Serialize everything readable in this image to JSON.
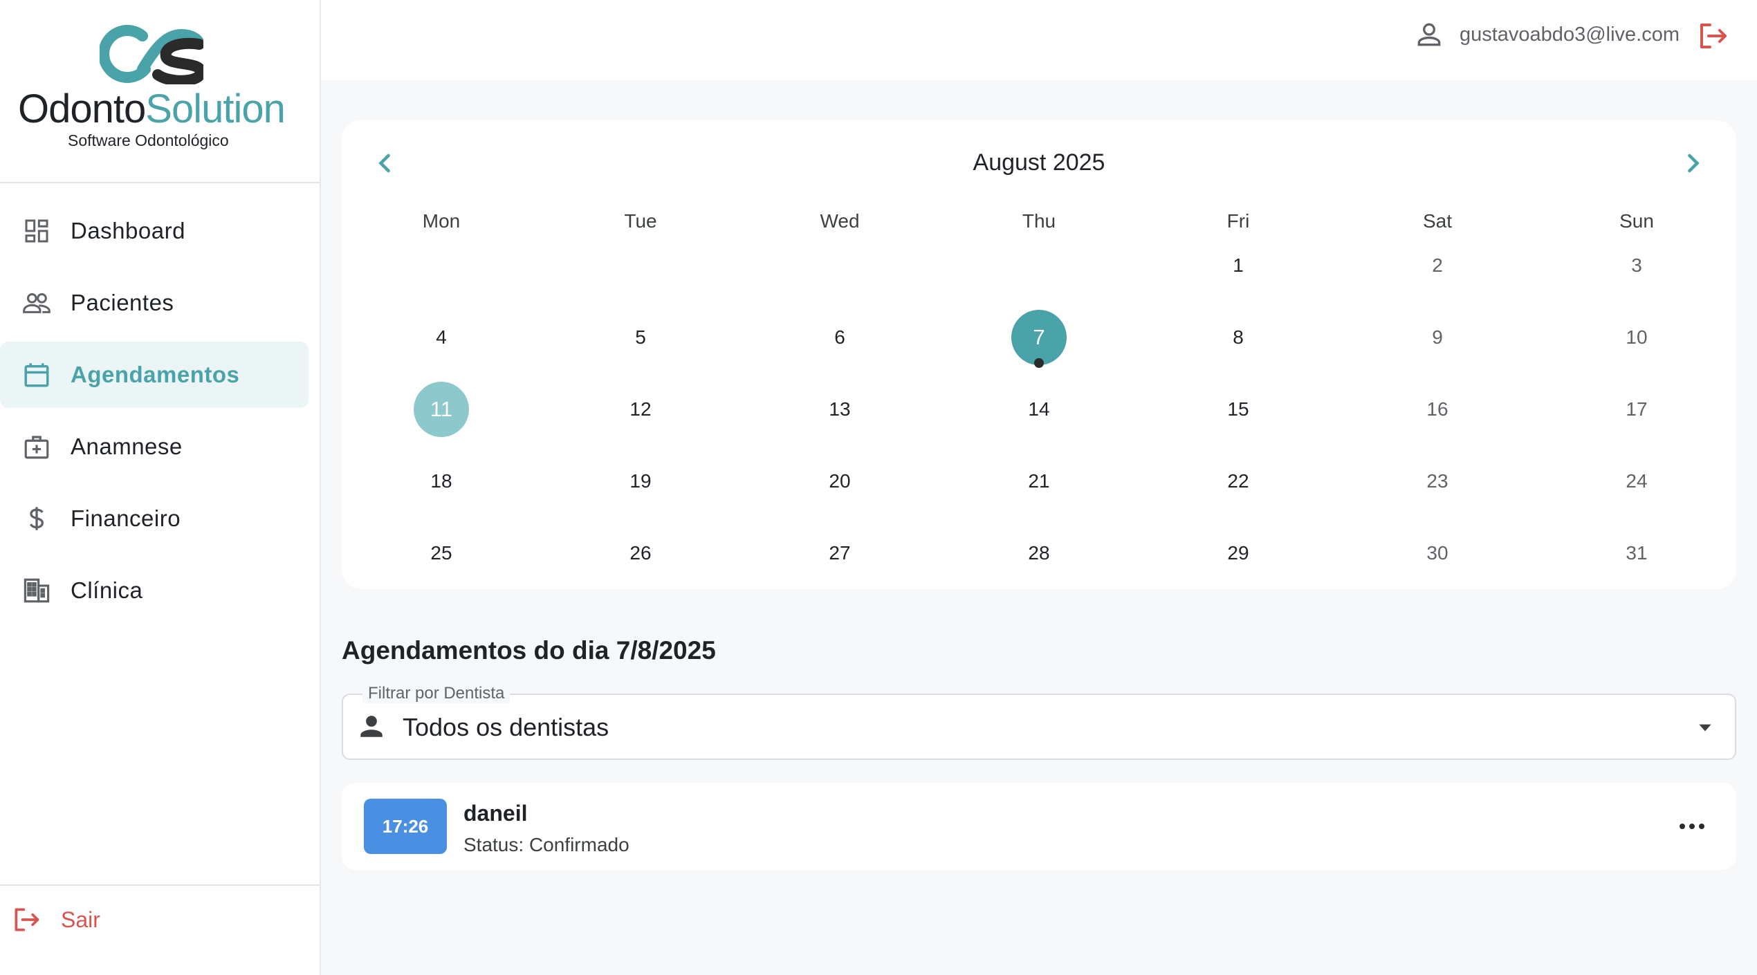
{
  "brand": {
    "name_part1": "Odonto",
    "name_part2": "Solution",
    "tagline": "Software Odontológico",
    "colors": {
      "teal": "#4aa3a8",
      "dark": "#1f2328"
    }
  },
  "sidebar": {
    "items": [
      {
        "label": "Dashboard",
        "icon": "dashboard-icon",
        "active": false
      },
      {
        "label": "Pacientes",
        "icon": "patients-icon",
        "active": false
      },
      {
        "label": "Agendamentos",
        "icon": "calendar-icon",
        "active": true
      },
      {
        "label": "Anamnese",
        "icon": "medical-bag-icon",
        "active": false
      },
      {
        "label": "Financeiro",
        "icon": "dollar-icon",
        "active": false
      },
      {
        "label": "Clínica",
        "icon": "building-icon",
        "active": false
      }
    ],
    "logout_label": "Sair"
  },
  "topbar": {
    "user_email": "gustavoabdo3@live.com"
  },
  "calendar": {
    "month_label": "August 2025",
    "weekdays": [
      "Mon",
      "Tue",
      "Wed",
      "Thu",
      "Fri",
      "Sat",
      "Sun"
    ],
    "first_weekday_index": 4,
    "days_in_month": 31,
    "selected_day": 7,
    "today_day": 11,
    "days_with_appointments": [
      7
    ]
  },
  "appointments": {
    "title": "Agendamentos do dia 7/8/2025",
    "filter": {
      "label": "Filtrar por Dentista",
      "value": "Todos os dentistas"
    },
    "items": [
      {
        "time": "17:26",
        "patient": "daneil",
        "status": "Status: Confirmado",
        "time_color": "#4a90e2"
      }
    ]
  }
}
